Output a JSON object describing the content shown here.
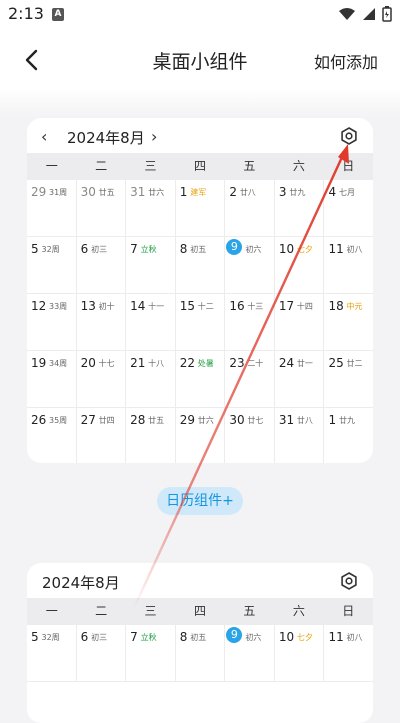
{
  "status": {
    "time": "2:13",
    "notif": "A"
  },
  "appbar": {
    "title": "桌面小组件",
    "action": "如何添加"
  },
  "calendar": {
    "month": "2024年8月",
    "weekdays": [
      "一",
      "二",
      "三",
      "四",
      "五",
      "六",
      "日"
    ]
  },
  "add_button": "日历组件+",
  "rows": [
    [
      [
        "29",
        "31周",
        "",
        "muted"
      ],
      [
        "30",
        "廿五",
        "",
        "muted"
      ],
      [
        "31",
        "廿六",
        "",
        "muted"
      ],
      [
        "1",
        "建军",
        "yellow",
        ""
      ],
      [
        "2",
        "廿八",
        "",
        ""
      ],
      [
        "3",
        "廿九",
        "",
        ""
      ],
      [
        "4",
        "七月",
        "",
        ""
      ]
    ],
    [
      [
        "5",
        "32周",
        "",
        ""
      ],
      [
        "6",
        "初三",
        "",
        ""
      ],
      [
        "7",
        "立秋",
        "green",
        ""
      ],
      [
        "8",
        "初五",
        "",
        ""
      ],
      [
        "9",
        "初六",
        "",
        "today"
      ],
      [
        "10",
        "七夕",
        "yellow",
        ""
      ],
      [
        "11",
        "初八",
        "",
        ""
      ]
    ],
    [
      [
        "12",
        "33周",
        "",
        ""
      ],
      [
        "13",
        "初十",
        "",
        ""
      ],
      [
        "14",
        "十一",
        "",
        ""
      ],
      [
        "15",
        "十二",
        "",
        ""
      ],
      [
        "16",
        "十三",
        "",
        ""
      ],
      [
        "17",
        "十四",
        "",
        ""
      ],
      [
        "18",
        "中元",
        "yellow",
        ""
      ]
    ],
    [
      [
        "19",
        "34周",
        "",
        ""
      ],
      [
        "20",
        "十七",
        "",
        ""
      ],
      [
        "21",
        "十八",
        "",
        ""
      ],
      [
        "22",
        "处暑",
        "green",
        ""
      ],
      [
        "23",
        "二十",
        "",
        ""
      ],
      [
        "24",
        "廿一",
        "",
        ""
      ],
      [
        "25",
        "廿二",
        "",
        ""
      ]
    ],
    [
      [
        "26",
        "35周",
        "",
        ""
      ],
      [
        "27",
        "廿四",
        "",
        ""
      ],
      [
        "28",
        "廿五",
        "",
        ""
      ],
      [
        "29",
        "廿六",
        "",
        ""
      ],
      [
        "30",
        "廿七",
        "",
        ""
      ],
      [
        "31",
        "廿八",
        "",
        ""
      ],
      [
        "1",
        "廿九",
        "",
        ""
      ]
    ]
  ],
  "colors": {
    "accent": "#2aa4e6",
    "arrow": "#e03a2c",
    "holiday_green": "#1a9c3e",
    "festival_yellow": "#e8a20a"
  }
}
